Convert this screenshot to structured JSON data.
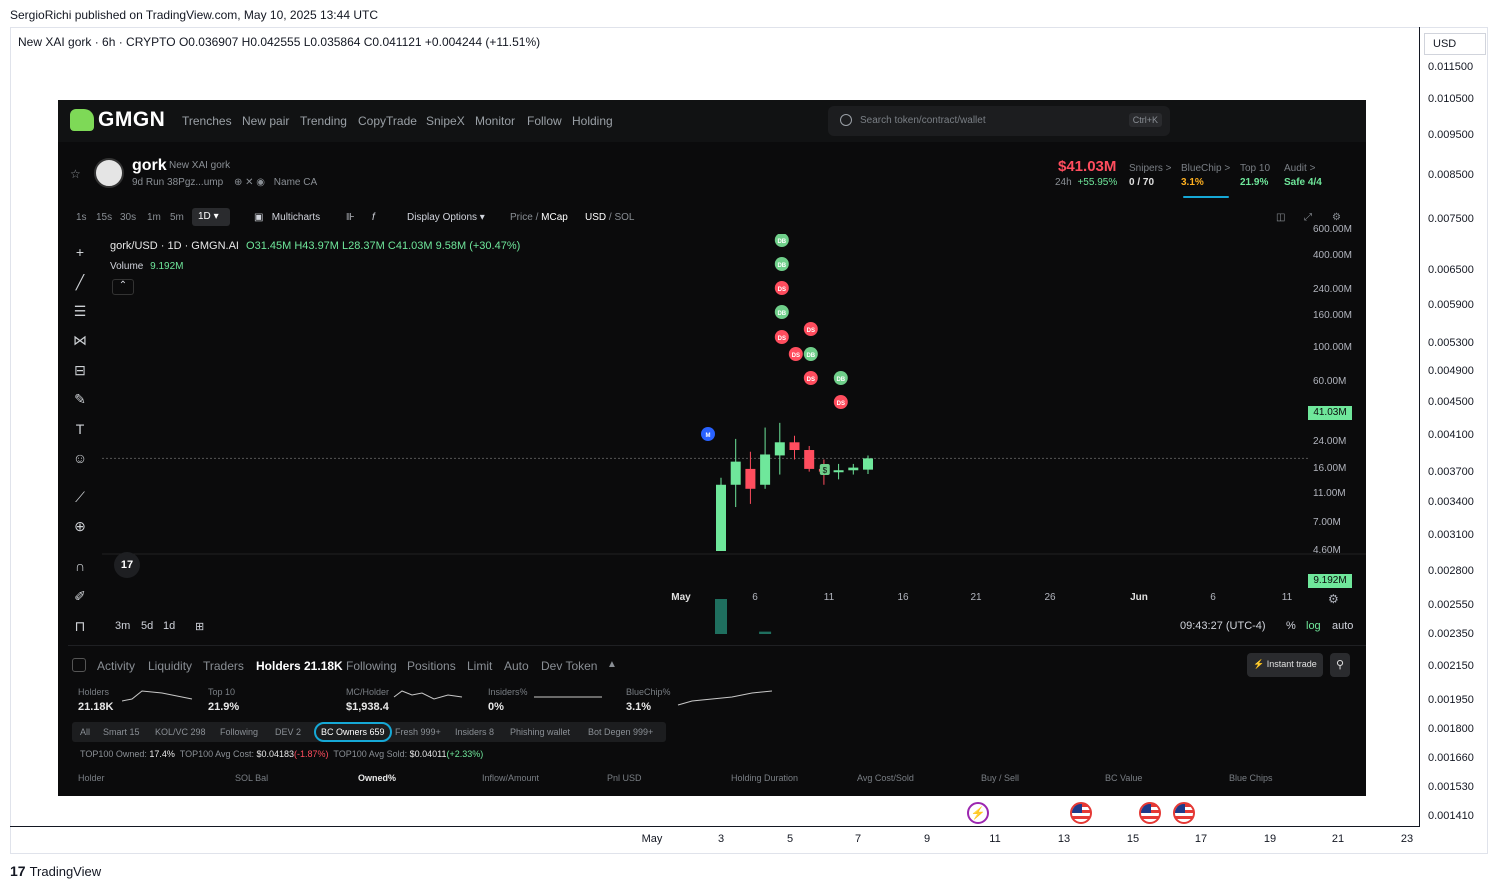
{
  "publisher": "SergioRichi published on TradingView.com, May 10, 2025 13:44 UTC",
  "legend": "New XAI gork · 6h · CRYPTO  O0.036907  H0.042555  L0.035864  C0.041121  +0.004244 (+11.51%)",
  "currency": "USD",
  "y_ticks": [
    "0.011500",
    "0.010500",
    "0.009500",
    "0.008500",
    "0.007500",
    "0.006500",
    "0.005900",
    "0.005300",
    "0.004900",
    "0.004500",
    "0.004100",
    "0.003700",
    "0.003400",
    "0.003100",
    "0.002800",
    "0.002550",
    "0.002350",
    "0.002150",
    "0.001950",
    "0.001800",
    "0.001660",
    "0.001530",
    "0.001410"
  ],
  "x_ticks": [
    "May",
    "3",
    "5",
    "7",
    "9",
    "11",
    "13",
    "15",
    "17",
    "19",
    "21",
    "23"
  ],
  "brand": "TradingView",
  "gmgn": {
    "logo": "GMGN",
    "nav": [
      "Trenches",
      "New pair",
      "Trending",
      "CopyTrade",
      "SnipeX",
      "Monitor",
      "Follow",
      "Holding"
    ],
    "search_placeholder": "Search token/contract/wallet",
    "search_kbd": "Ctrl+K",
    "token": {
      "symbol": "gork",
      "full_name": "New XAI gork",
      "age_line": "9d  Run  38Pgz...ump",
      "links": "Name  CA",
      "mcap": "$41.03M",
      "change_24h_label": "24h",
      "change_24h": "+55.95%"
    },
    "stats": [
      {
        "label": "Snipers >",
        "value": "0 / 70",
        "color": "#e0e0e0"
      },
      {
        "label": "BlueChip >",
        "value": "3.1%",
        "color": "#ffb020"
      },
      {
        "label": "Top 10",
        "value": "21.9%",
        "color": "#6fe79b"
      },
      {
        "label": "Audit >",
        "value": "Safe 4/4",
        "color": "#6fe79b"
      }
    ],
    "timeframes": [
      "1s",
      "15s",
      "30s",
      "1m",
      "5m"
    ],
    "timeframe_active": "1D",
    "toolbar": {
      "multicharts": "Multicharts",
      "display_options": "Display Options",
      "price": "Price",
      "mcap": "MCap",
      "usd": "USD",
      "sol": "SOL"
    },
    "ohlc_title": "gork/USD · 1D · GMGN.AI",
    "ohlc_values": "O31.45M H43.97M L28.37M C41.03M 9.58M (+30.47%)",
    "volume_label": "Volume",
    "volume_value": "9.192M",
    "price_ticks": [
      "600.00M",
      "400.00M",
      "240.00M",
      "160.00M",
      "100.00M",
      "60.00M",
      "24.00M",
      "16.00M",
      "11.00M",
      "7.00M",
      "4.60M"
    ],
    "last_price": "41.03M",
    "volume_tag": "9.192M",
    "chart_x_ticks": [
      "May",
      "6",
      "11",
      "16",
      "21",
      "26",
      "Jun",
      "6",
      "11"
    ],
    "ranges": [
      "3m",
      "5d",
      "1d"
    ],
    "clock": "09:43:27 (UTC-4)",
    "scale_opts": [
      "%",
      "log",
      "auto"
    ],
    "tabs": [
      "Activity",
      "Liquidity",
      "Traders",
      "Holders 21.18K",
      "Following",
      "Positions",
      "Limit",
      "Auto",
      "Dev Token"
    ],
    "instant_trade": "Instant trade",
    "metrics": [
      {
        "label": "Holders",
        "value": "21.18K"
      },
      {
        "label": "Top 10",
        "value": "21.9%"
      },
      {
        "label": "MC/Holder",
        "value": "$1,938.4"
      },
      {
        "label": "Insiders%",
        "value": "0%"
      },
      {
        "label": "BlueChip%",
        "value": "3.1%"
      }
    ],
    "filters": [
      "All",
      "Smart 15",
      "KOL/VC 298",
      "Following",
      "DEV 2",
      "BC Owners 659",
      "Fresh 999+",
      "Insiders 8",
      "Phishing wallet",
      "Bot Degen 999+"
    ],
    "owned_line": {
      "label1": "TOP100 Owned:",
      "val1": "17.4%",
      "label2": "TOP100 Avg Cost:",
      "val2": "$0.04183",
      "val2b": "(-1.87%)",
      "label3": "TOP100 Avg Sold:",
      "val3": "$0.04011",
      "val3b": "(+2.33%)"
    },
    "columns": [
      "Holder",
      "SOL Bal",
      "Owned%",
      "Inflow/Amount",
      "Pnl  USD",
      "Holding Duration",
      "Avg Cost/Sold",
      "Buy / Sell",
      "BC Value",
      "Blue Chips"
    ]
  },
  "chart_data": {
    "type": "candlestick",
    "note_markers": [
      "DB",
      "DS",
      "M",
      "$"
    ],
    "candles": [
      {
        "o": 4.6,
        "h": 26,
        "l": 4.6,
        "c": 22
      },
      {
        "o": 22,
        "h": 65,
        "l": 13,
        "c": 38
      },
      {
        "o": 32,
        "h": 48,
        "l": 14,
        "c": 20
      },
      {
        "o": 22,
        "h": 85,
        "l": 20,
        "c": 45
      },
      {
        "o": 44,
        "h": 95,
        "l": 28,
        "c": 60
      },
      {
        "o": 60,
        "h": 70,
        "l": 40,
        "c": 50
      },
      {
        "o": 50,
        "h": 55,
        "l": 30,
        "c": 32
      },
      {
        "o": 32,
        "h": 40,
        "l": 22,
        "c": 30
      },
      {
        "o": 30,
        "h": 36,
        "l": 25,
        "c": 31
      },
      {
        "o": 31,
        "h": 36,
        "l": 28,
        "c": 33
      },
      {
        "o": 31.45,
        "h": 43.97,
        "l": 28.37,
        "c": 41.03
      }
    ],
    "volumes": [
      8.0,
      3.0,
      1.0,
      5.0,
      2.1,
      1.2,
      0.8,
      0.5,
      0.3,
      0.2,
      0.15
    ]
  }
}
